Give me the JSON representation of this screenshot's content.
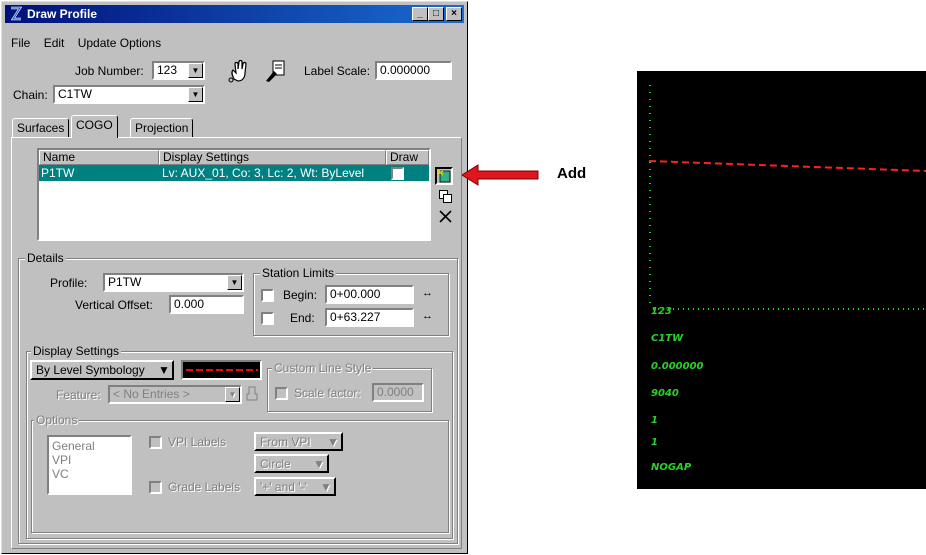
{
  "window": {
    "title": "Draw Profile",
    "controls": [
      "_",
      "□",
      "×"
    ]
  },
  "menu": [
    "File",
    "Edit",
    "Update Options"
  ],
  "header": {
    "job_number_label": "Job Number:",
    "job_number_value": "123",
    "label_scale_label": "Label Scale:",
    "label_scale_value": "0.000000",
    "chain_label": "Chain:",
    "chain_value": "C1TW"
  },
  "tabs": [
    {
      "label": "Surfaces",
      "active": false
    },
    {
      "label": "COGO",
      "active": true
    },
    {
      "label": "Projection",
      "active": false
    }
  ],
  "table": {
    "columns": [
      "Name",
      "Display Settings",
      "Draw"
    ],
    "rows": [
      {
        "name": "P1TW",
        "display": "Lv: AUX_01, Co: 3, Lc: 2, Wt: ByLevel",
        "draw": true
      }
    ]
  },
  "side_buttons": [
    "add-icon",
    "copy-icon",
    "delete-icon"
  ],
  "annotation": {
    "label": "Add",
    "arrow_color": "#e0151d"
  },
  "details": {
    "group_label": "Details",
    "profile_label": "Profile:",
    "profile_value": "P1TW",
    "vertical_offset_label": "Vertical Offset:",
    "vertical_offset_value": "0.000",
    "station_limits_label": "Station Limits",
    "begin_label": "Begin:",
    "begin_value": "0+00.000",
    "end_label": "End:",
    "end_value": "0+63.227"
  },
  "display_settings": {
    "group_label": "Display Settings",
    "symbology_value": "By Level Symbology",
    "line_color": "#ff0000",
    "custom_line_style_label": "Custom Line Style",
    "feature_label": "Feature:",
    "feature_value": "< No Entries >",
    "scale_factor_label": "Scale factor:",
    "scale_factor_value": "0.0000"
  },
  "options": {
    "group_label": "Options",
    "list": [
      "General",
      "VPI",
      "VC"
    ],
    "vpi_labels_label": "VPI Labels",
    "from_vpi_value": "From VPI",
    "circle_value": "Circle",
    "grade_labels_label": "Grade Labels",
    "grade_value": "'+' and '-'"
  },
  "terminal": {
    "lines": [
      "123",
      "C1TW",
      "0.000000",
      "9040",
      "1",
      "1",
      "NOGAP"
    ],
    "text_color": "#2bd12b",
    "profile_line_color": "#ff2020"
  }
}
